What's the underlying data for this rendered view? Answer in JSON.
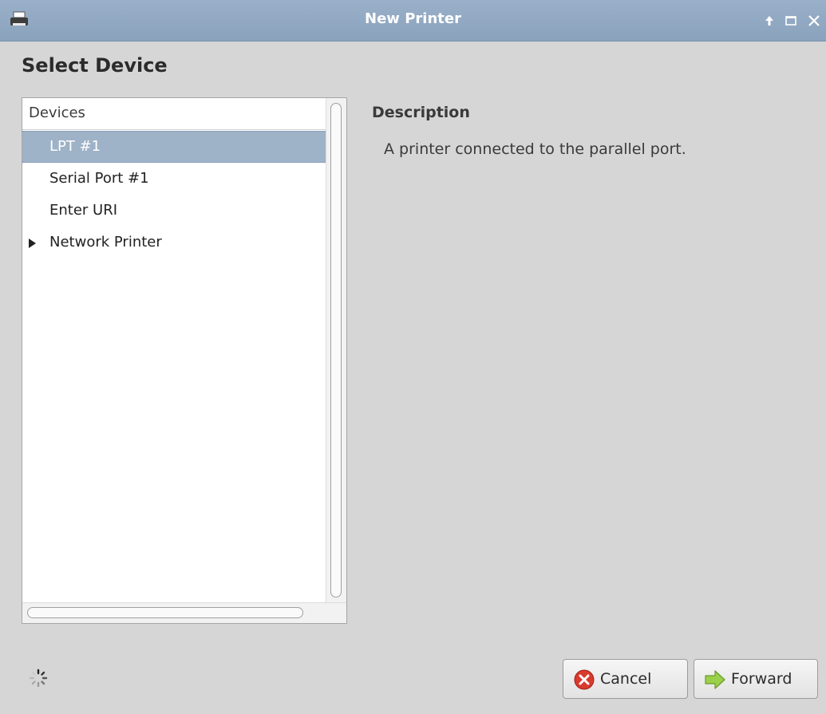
{
  "window": {
    "title": "New Printer",
    "app_icon": "printer-icon",
    "controls": [
      "raise-icon",
      "maximize-icon",
      "close-icon"
    ]
  },
  "page": {
    "heading": "Select Device"
  },
  "devices": {
    "column_header": "Devices",
    "items": [
      {
        "label": "LPT #1",
        "selected": true
      },
      {
        "label": "Serial Port #1",
        "selected": false
      },
      {
        "label": "Enter URI",
        "selected": false
      },
      {
        "label": "Network Printer",
        "selected": false,
        "expandable": true
      }
    ]
  },
  "description": {
    "heading": "Description",
    "text": "A printer connected to the parallel port."
  },
  "footer": {
    "spinner_icon": "spinner-icon",
    "cancel_label": "Cancel",
    "forward_label": "Forward"
  },
  "colors": {
    "titlebar": "#8aa2bd",
    "selection": "#9eb2c8",
    "window_bg": "#d6d6d6"
  }
}
